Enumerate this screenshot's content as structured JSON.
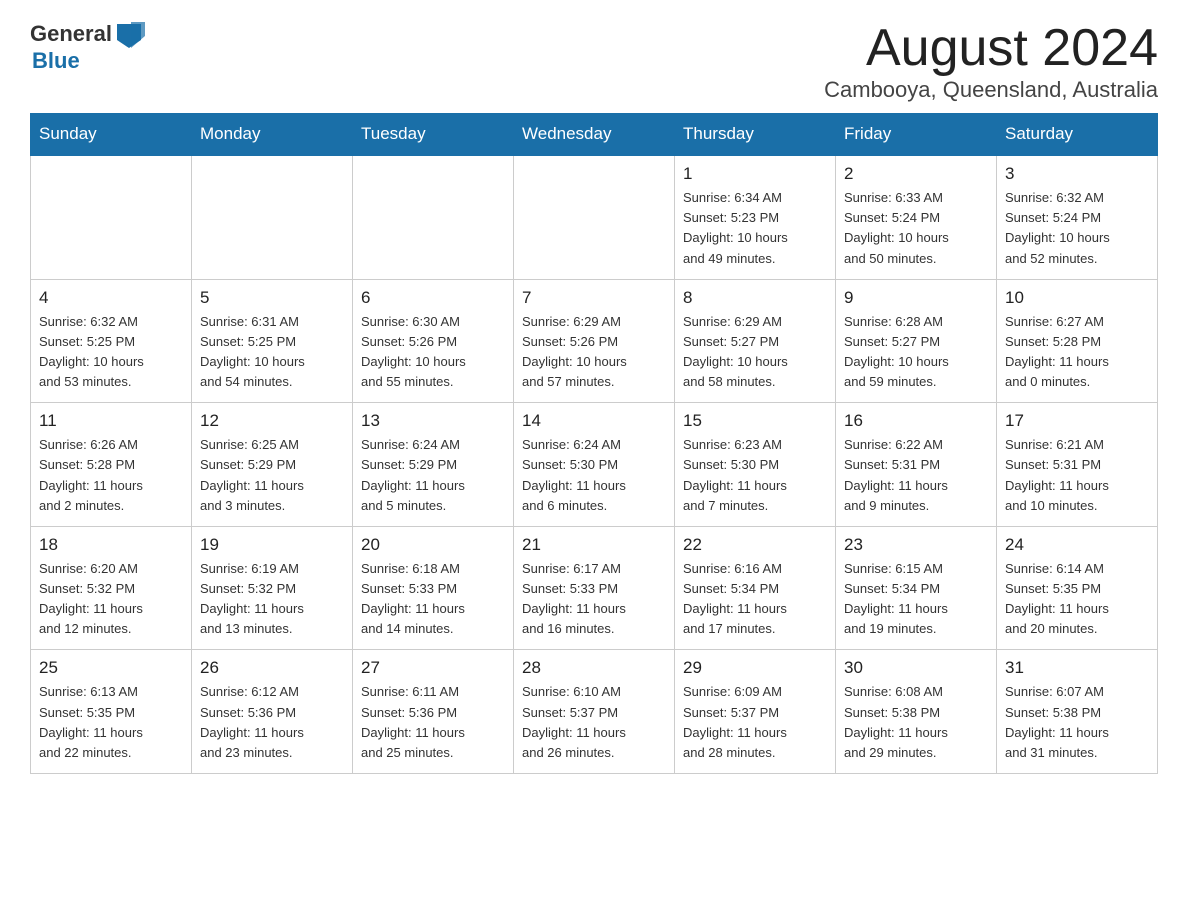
{
  "header": {
    "logo_general": "General",
    "logo_blue": "Blue",
    "month_title": "August 2024",
    "location": "Cambooya, Queensland, Australia"
  },
  "days_of_week": [
    "Sunday",
    "Monday",
    "Tuesday",
    "Wednesday",
    "Thursday",
    "Friday",
    "Saturday"
  ],
  "weeks": [
    {
      "days": [
        {
          "number": "",
          "info": ""
        },
        {
          "number": "",
          "info": ""
        },
        {
          "number": "",
          "info": ""
        },
        {
          "number": "",
          "info": ""
        },
        {
          "number": "1",
          "info": "Sunrise: 6:34 AM\nSunset: 5:23 PM\nDaylight: 10 hours\nand 49 minutes."
        },
        {
          "number": "2",
          "info": "Sunrise: 6:33 AM\nSunset: 5:24 PM\nDaylight: 10 hours\nand 50 minutes."
        },
        {
          "number": "3",
          "info": "Sunrise: 6:32 AM\nSunset: 5:24 PM\nDaylight: 10 hours\nand 52 minutes."
        }
      ]
    },
    {
      "days": [
        {
          "number": "4",
          "info": "Sunrise: 6:32 AM\nSunset: 5:25 PM\nDaylight: 10 hours\nand 53 minutes."
        },
        {
          "number": "5",
          "info": "Sunrise: 6:31 AM\nSunset: 5:25 PM\nDaylight: 10 hours\nand 54 minutes."
        },
        {
          "number": "6",
          "info": "Sunrise: 6:30 AM\nSunset: 5:26 PM\nDaylight: 10 hours\nand 55 minutes."
        },
        {
          "number": "7",
          "info": "Sunrise: 6:29 AM\nSunset: 5:26 PM\nDaylight: 10 hours\nand 57 minutes."
        },
        {
          "number": "8",
          "info": "Sunrise: 6:29 AM\nSunset: 5:27 PM\nDaylight: 10 hours\nand 58 minutes."
        },
        {
          "number": "9",
          "info": "Sunrise: 6:28 AM\nSunset: 5:27 PM\nDaylight: 10 hours\nand 59 minutes."
        },
        {
          "number": "10",
          "info": "Sunrise: 6:27 AM\nSunset: 5:28 PM\nDaylight: 11 hours\nand 0 minutes."
        }
      ]
    },
    {
      "days": [
        {
          "number": "11",
          "info": "Sunrise: 6:26 AM\nSunset: 5:28 PM\nDaylight: 11 hours\nand 2 minutes."
        },
        {
          "number": "12",
          "info": "Sunrise: 6:25 AM\nSunset: 5:29 PM\nDaylight: 11 hours\nand 3 minutes."
        },
        {
          "number": "13",
          "info": "Sunrise: 6:24 AM\nSunset: 5:29 PM\nDaylight: 11 hours\nand 5 minutes."
        },
        {
          "number": "14",
          "info": "Sunrise: 6:24 AM\nSunset: 5:30 PM\nDaylight: 11 hours\nand 6 minutes."
        },
        {
          "number": "15",
          "info": "Sunrise: 6:23 AM\nSunset: 5:30 PM\nDaylight: 11 hours\nand 7 minutes."
        },
        {
          "number": "16",
          "info": "Sunrise: 6:22 AM\nSunset: 5:31 PM\nDaylight: 11 hours\nand 9 minutes."
        },
        {
          "number": "17",
          "info": "Sunrise: 6:21 AM\nSunset: 5:31 PM\nDaylight: 11 hours\nand 10 minutes."
        }
      ]
    },
    {
      "days": [
        {
          "number": "18",
          "info": "Sunrise: 6:20 AM\nSunset: 5:32 PM\nDaylight: 11 hours\nand 12 minutes."
        },
        {
          "number": "19",
          "info": "Sunrise: 6:19 AM\nSunset: 5:32 PM\nDaylight: 11 hours\nand 13 minutes."
        },
        {
          "number": "20",
          "info": "Sunrise: 6:18 AM\nSunset: 5:33 PM\nDaylight: 11 hours\nand 14 minutes."
        },
        {
          "number": "21",
          "info": "Sunrise: 6:17 AM\nSunset: 5:33 PM\nDaylight: 11 hours\nand 16 minutes."
        },
        {
          "number": "22",
          "info": "Sunrise: 6:16 AM\nSunset: 5:34 PM\nDaylight: 11 hours\nand 17 minutes."
        },
        {
          "number": "23",
          "info": "Sunrise: 6:15 AM\nSunset: 5:34 PM\nDaylight: 11 hours\nand 19 minutes."
        },
        {
          "number": "24",
          "info": "Sunrise: 6:14 AM\nSunset: 5:35 PM\nDaylight: 11 hours\nand 20 minutes."
        }
      ]
    },
    {
      "days": [
        {
          "number": "25",
          "info": "Sunrise: 6:13 AM\nSunset: 5:35 PM\nDaylight: 11 hours\nand 22 minutes."
        },
        {
          "number": "26",
          "info": "Sunrise: 6:12 AM\nSunset: 5:36 PM\nDaylight: 11 hours\nand 23 minutes."
        },
        {
          "number": "27",
          "info": "Sunrise: 6:11 AM\nSunset: 5:36 PM\nDaylight: 11 hours\nand 25 minutes."
        },
        {
          "number": "28",
          "info": "Sunrise: 6:10 AM\nSunset: 5:37 PM\nDaylight: 11 hours\nand 26 minutes."
        },
        {
          "number": "29",
          "info": "Sunrise: 6:09 AM\nSunset: 5:37 PM\nDaylight: 11 hours\nand 28 minutes."
        },
        {
          "number": "30",
          "info": "Sunrise: 6:08 AM\nSunset: 5:38 PM\nDaylight: 11 hours\nand 29 minutes."
        },
        {
          "number": "31",
          "info": "Sunrise: 6:07 AM\nSunset: 5:38 PM\nDaylight: 11 hours\nand 31 minutes."
        }
      ]
    }
  ]
}
